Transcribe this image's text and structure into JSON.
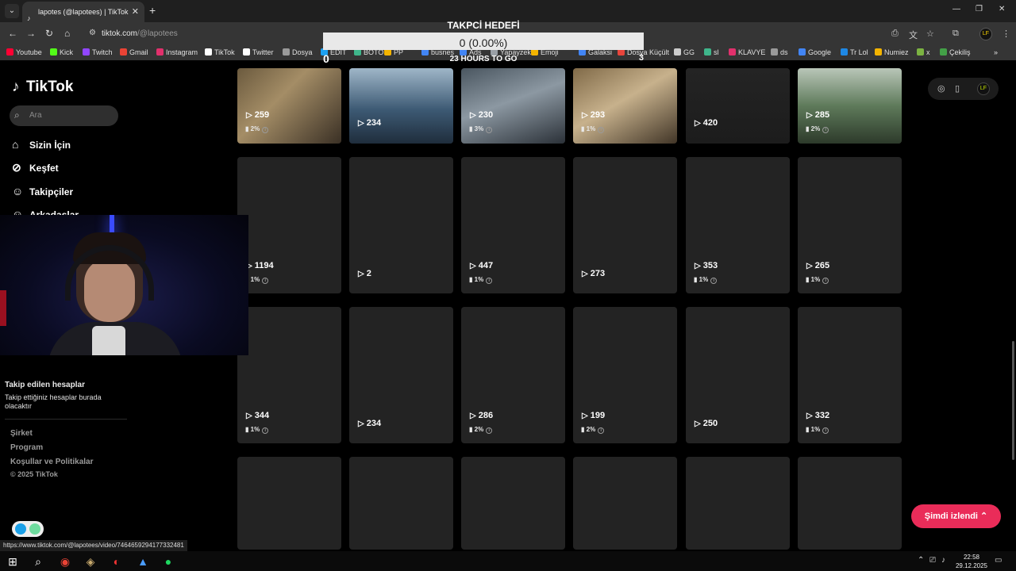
{
  "browser": {
    "tab_title": "lapotes (@lapotees) | TikTok",
    "tab_favicon": "tiktok-icon",
    "url_host": "tiktok.com",
    "url_path": "/@lapotees",
    "bookmarks": [
      {
        "label": "Youtube",
        "color": "#ff0033"
      },
      {
        "label": "Kick",
        "color": "#53fc18"
      },
      {
        "label": "Twitch",
        "color": "#9146ff"
      },
      {
        "label": "Gmail",
        "color": "#ea4335"
      },
      {
        "label": "Instagram",
        "color": "#e1306c"
      },
      {
        "label": "TikTok",
        "color": "#ffffff"
      },
      {
        "label": "Twitter",
        "color": "#ffffff"
      },
      {
        "label": "Dosya",
        "color": "#9a9a9a"
      },
      {
        "label": "EDIT",
        "color": "#1da1f2"
      },
      {
        "label": "BOTOT",
        "color": "#3fb68b"
      },
      {
        "label": "PP",
        "color": "#f4b400"
      },
      {
        "label": "busnes",
        "color": "#4285f4"
      },
      {
        "label": "Ads",
        "color": "#4285f4"
      },
      {
        "label": "Yapayzeka",
        "color": "#9aa0a6"
      },
      {
        "label": "Emoji",
        "color": "#f4b400"
      },
      {
        "label": "Galaksi",
        "color": "#4285f4"
      },
      {
        "label": "Dosya Küçült",
        "color": "#e8453c"
      },
      {
        "label": "GG",
        "color": "#cccccc"
      },
      {
        "label": "sl",
        "color": "#3fb68b"
      },
      {
        "label": "KLAVYE",
        "color": "#e1306c"
      },
      {
        "label": "ds",
        "color": "#9a9a9a"
      },
      {
        "label": "Google",
        "color": "#4285f4"
      },
      {
        "label": "Tr Lol",
        "color": "#1e88e5"
      },
      {
        "label": "Numiez",
        "color": "#f4b400"
      },
      {
        "label": "x",
        "color": "#7cb342"
      },
      {
        "label": "Çekiliş",
        "color": "#43a047"
      }
    ],
    "profile_initials": "LF"
  },
  "goal": {
    "title": "TAKPCİ HEDEFİ",
    "value": "0 (0.00%)",
    "progress_fraction": 0.0,
    "min": "0",
    "max": "3",
    "time_left": "23 HOURS TO GO"
  },
  "sidebar": {
    "logo": "TikTok",
    "search_placeholder": "Ara",
    "nav": [
      {
        "label": "Sizin İçin",
        "icon": "home-icon"
      },
      {
        "label": "Keşfet",
        "icon": "compass-icon"
      },
      {
        "label": "Takipçiler",
        "icon": "followers-icon"
      },
      {
        "label": "Arkadaşlar",
        "icon": "friends-icon"
      }
    ],
    "following_title": "Takip edilen hesaplar",
    "following_desc": "Takip ettiğiniz hesaplar burada olacaktır",
    "footer": [
      "Şirket",
      "Program",
      "Koşullar ve Politikalar"
    ],
    "copyright": "© 2025 TikTok"
  },
  "videos": [
    {
      "views": "259",
      "pct": "2%"
    },
    {
      "views": "234",
      "pct": ""
    },
    {
      "views": "230",
      "pct": "3%"
    },
    {
      "views": "293",
      "pct": "1%"
    },
    {
      "views": "420",
      "pct": ""
    },
    {
      "views": "285",
      "pct": "2%"
    },
    {
      "views": "1194",
      "pct": "1%"
    },
    {
      "views": "2",
      "pct": ""
    },
    {
      "views": "447",
      "pct": "1%"
    },
    {
      "views": "273",
      "pct": ""
    },
    {
      "views": "353",
      "pct": "1%"
    },
    {
      "views": "265",
      "pct": "1%"
    },
    {
      "views": "344",
      "pct": "1%"
    },
    {
      "views": "234",
      "pct": ""
    },
    {
      "views": "286",
      "pct": "2%"
    },
    {
      "views": "199",
      "pct": "2%"
    },
    {
      "views": "250",
      "pct": ""
    },
    {
      "views": "332",
      "pct": "1%"
    },
    {
      "views": "",
      "pct": ""
    },
    {
      "views": "",
      "pct": ""
    },
    {
      "views": "",
      "pct": ""
    },
    {
      "views": "",
      "pct": ""
    },
    {
      "views": "",
      "pct": ""
    },
    {
      "views": "",
      "pct": ""
    }
  ],
  "now_watching": "Şimdi izlendi",
  "status_url": "https://www.tiktok.com/@lapotees/video/7464659294177332481",
  "taskbar": {
    "time": "22:58",
    "date": "29.12.2025"
  }
}
